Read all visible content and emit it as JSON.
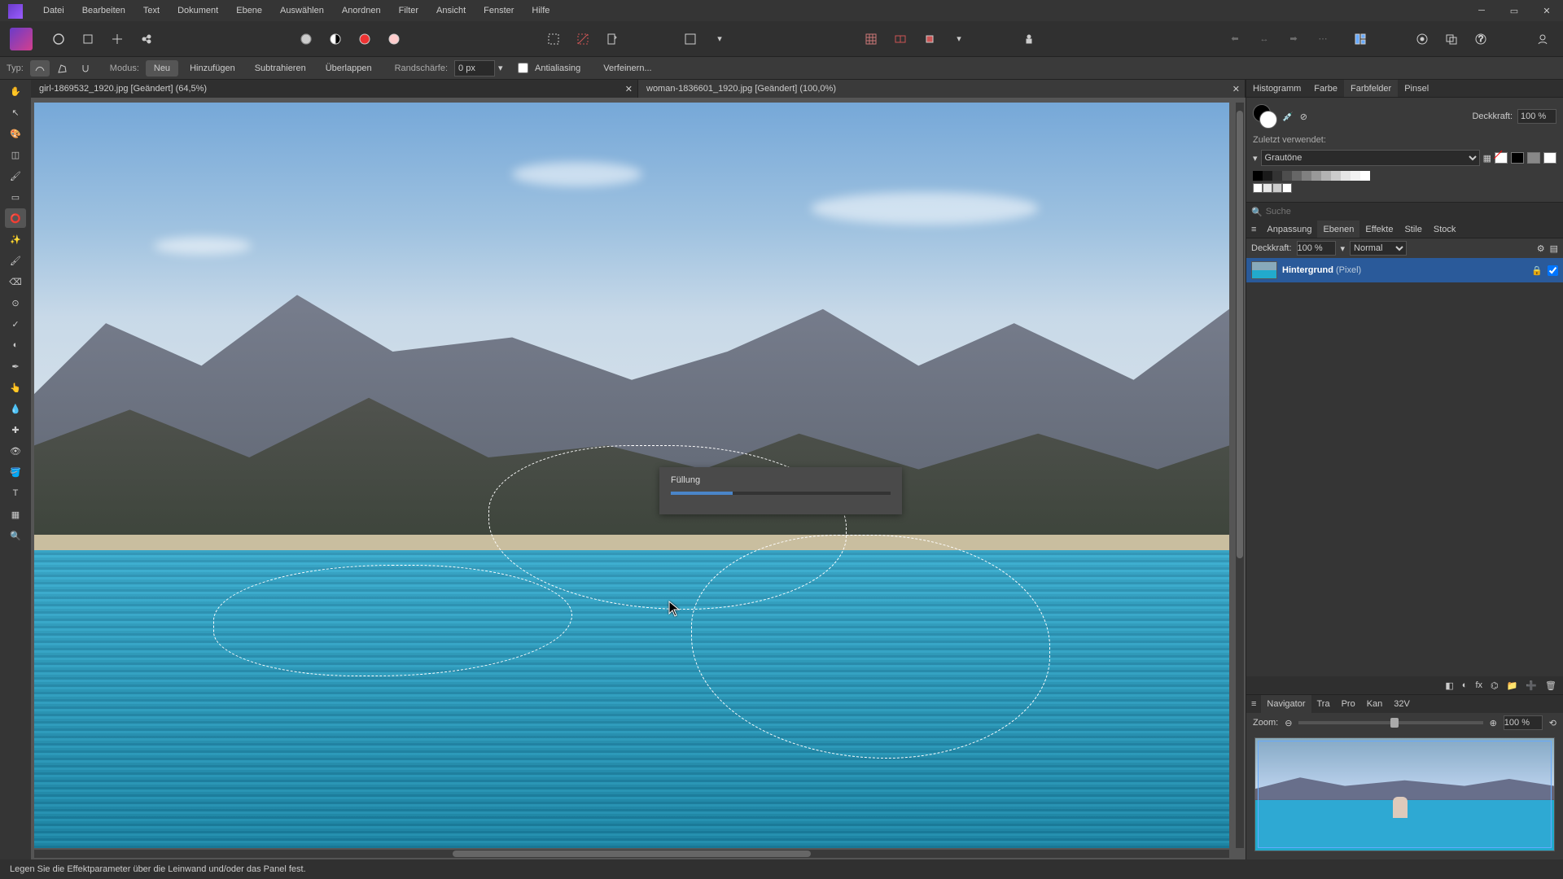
{
  "menubar": {
    "items": [
      "Datei",
      "Bearbeiten",
      "Text",
      "Dokument",
      "Ebene",
      "Auswählen",
      "Anordnen",
      "Filter",
      "Ansicht",
      "Fenster",
      "Hilfe"
    ]
  },
  "context": {
    "typ_label": "Typ:",
    "modus_label": "Modus:",
    "modes": [
      "Neu",
      "Hinzufügen",
      "Subtrahieren",
      "Überlappen"
    ],
    "active_mode": "Neu",
    "randschaerfe_label": "Randschärfe:",
    "randschaerfe_value": "0 px",
    "antialiasing_label": "Antialiasing",
    "antialiasing_checked": false,
    "verfeinern_label": "Verfeinern..."
  },
  "tabs": {
    "items": [
      {
        "title": "girl-1869532_1920.jpg [Geändert] (64,5%)",
        "active": false
      },
      {
        "title": "woman-1836601_1920.jpg [Geändert] (100,0%)",
        "active": true
      }
    ]
  },
  "dialog": {
    "title": "Füllung",
    "progress_pct": 28
  },
  "swatches": {
    "tabs": [
      "Histogramm",
      "Farbe",
      "Farbfelder",
      "Pinsel"
    ],
    "active_tab": "Farbfelder",
    "deckkraft_label": "Deckkraft:",
    "deckkraft_value": "100 %",
    "recent_label": "Zuletzt verwendet:",
    "preset_name": "Grautöne",
    "gray_steps": [
      "#000000",
      "#1a1a1a",
      "#333333",
      "#4d4d4d",
      "#666666",
      "#808080",
      "#999999",
      "#b3b3b3",
      "#cccccc",
      "#e6e6e6",
      "#f2f2f2",
      "#ffffff"
    ],
    "recent_swatches": [
      "#ffffff",
      "#e6e6e6",
      "#cccccc",
      "#ffffff"
    ]
  },
  "layers": {
    "search_placeholder": "Suche",
    "subtabs": [
      "Anpassung",
      "Ebenen",
      "Effekte",
      "Stile",
      "Stock"
    ],
    "active_subtab": "Ebenen",
    "deckkraft_label": "Deckkraft:",
    "deckkraft_value": "100 %",
    "blend_mode": "Normal",
    "items": [
      {
        "name": "Hintergrund",
        "type": "(Pixel)",
        "visible": true,
        "locked": true
      }
    ]
  },
  "navigator": {
    "tabs": [
      "Navigator",
      "Tra",
      "Pro",
      "Kan",
      "32V"
    ],
    "active_tab": "Navigator",
    "zoom_label": "Zoom:",
    "zoom_value": "100 %"
  },
  "statusbar": {
    "hint": "Legen Sie die Effektparameter über die Leinwand und/oder das Panel fest."
  }
}
